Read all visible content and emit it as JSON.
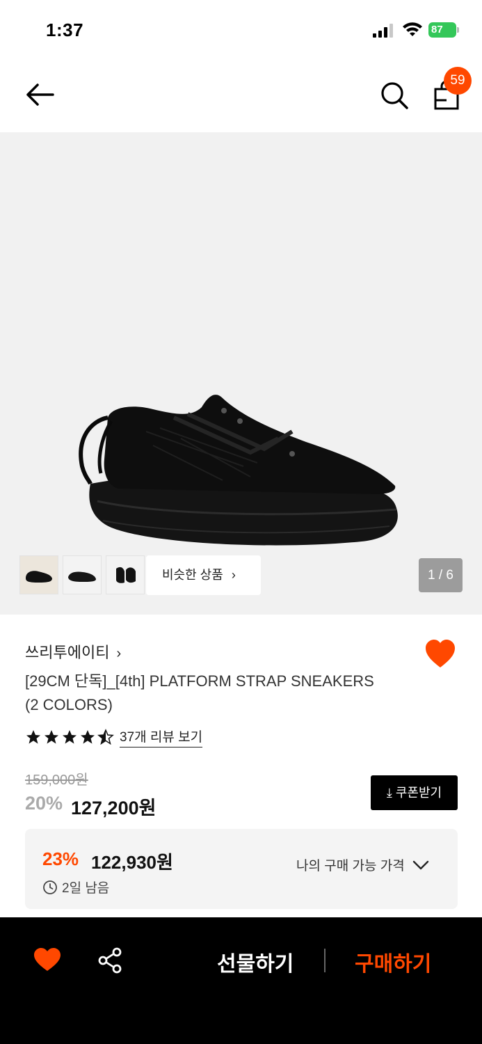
{
  "status_bar": {
    "time": "1:37",
    "battery": "87"
  },
  "header": {
    "cart_count": "59"
  },
  "gallery": {
    "similar_label": "비슷한 상품",
    "page_indicator": "1 / 6",
    "thumbnail_count": 3
  },
  "product": {
    "brand": "쓰리투에이티",
    "title_line1": "[29CM 단독]_[4th] PLATFORM STRAP SNEAKERS",
    "title_line2": "(2 COLORS)",
    "rating": 4.5,
    "review_link": "37개 리뷰 보기",
    "original_price": "159,000원",
    "discount_rate": "20%",
    "price": "127,200원",
    "coupon_label": "쿠폰받기",
    "liked": true
  },
  "best_price": {
    "rate": "23%",
    "price": "122,930원",
    "time_left": "2일 남음",
    "toggle_label": "나의 구매 가능 가격"
  },
  "bottom_bar": {
    "gift_label": "선물하기",
    "buy_label": "구매하기"
  },
  "colors": {
    "accent": "#ff4800",
    "battery": "#34c759"
  }
}
